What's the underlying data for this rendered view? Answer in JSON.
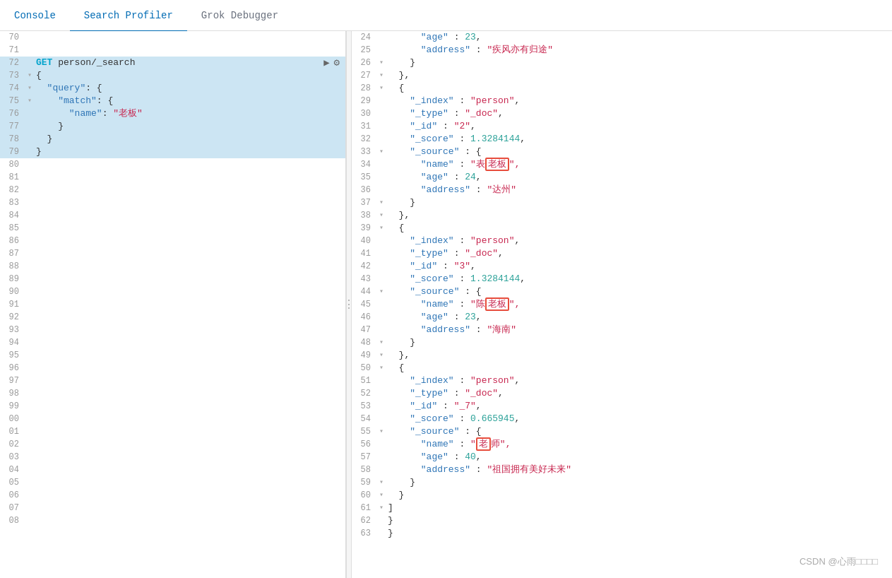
{
  "nav": {
    "items": [
      {
        "label": "Console",
        "active": false
      },
      {
        "label": "Search Profiler",
        "active": true
      },
      {
        "label": "Grok Debugger",
        "active": false
      }
    ]
  },
  "editor": {
    "lines": [
      {
        "num": "70",
        "fold": "",
        "content": ""
      },
      {
        "num": "71",
        "fold": "",
        "content": ""
      },
      {
        "num": "72",
        "fold": "",
        "content": "GET person/_search",
        "highlighted": true,
        "isGetLine": true
      },
      {
        "num": "73",
        "fold": "▾",
        "content": "{",
        "highlighted": true
      },
      {
        "num": "74",
        "fold": "▾",
        "content": "  \"query\": {",
        "highlighted": true
      },
      {
        "num": "75",
        "fold": "▾",
        "content": "    \"match\": {",
        "highlighted": true
      },
      {
        "num": "76",
        "fold": "",
        "content": "      \"name\": \"老板\"",
        "highlighted": true
      },
      {
        "num": "77",
        "fold": "",
        "content": "    }",
        "highlighted": true
      },
      {
        "num": "78",
        "fold": "",
        "content": "  }",
        "highlighted": true
      },
      {
        "num": "79",
        "fold": "",
        "content": "}",
        "highlighted": true
      },
      {
        "num": "80",
        "fold": "",
        "content": ""
      },
      {
        "num": "81",
        "fold": "",
        "content": ""
      },
      {
        "num": "82",
        "fold": "",
        "content": ""
      },
      {
        "num": "83",
        "fold": "",
        "content": ""
      },
      {
        "num": "84",
        "fold": "",
        "content": ""
      },
      {
        "num": "85",
        "fold": "",
        "content": ""
      },
      {
        "num": "86",
        "fold": "",
        "content": ""
      },
      {
        "num": "87",
        "fold": "",
        "content": ""
      },
      {
        "num": "88",
        "fold": "",
        "content": ""
      },
      {
        "num": "89",
        "fold": "",
        "content": ""
      },
      {
        "num": "90",
        "fold": "",
        "content": ""
      },
      {
        "num": "91",
        "fold": "",
        "content": ""
      },
      {
        "num": "92",
        "fold": "",
        "content": ""
      },
      {
        "num": "93",
        "fold": "",
        "content": ""
      },
      {
        "num": "94",
        "fold": "",
        "content": ""
      },
      {
        "num": "95",
        "fold": "",
        "content": ""
      },
      {
        "num": "96",
        "fold": "",
        "content": ""
      },
      {
        "num": "97",
        "fold": "",
        "content": ""
      },
      {
        "num": "98",
        "fold": "",
        "content": ""
      },
      {
        "num": "99",
        "fold": "",
        "content": ""
      },
      {
        "num": "00",
        "fold": "",
        "content": ""
      },
      {
        "num": "01",
        "fold": "",
        "content": ""
      },
      {
        "num": "02",
        "fold": "",
        "content": ""
      },
      {
        "num": "03",
        "fold": "",
        "content": ""
      },
      {
        "num": "04",
        "fold": "",
        "content": ""
      },
      {
        "num": "05",
        "fold": "",
        "content": ""
      },
      {
        "num": "06",
        "fold": "",
        "content": ""
      },
      {
        "num": "07",
        "fold": "",
        "content": ""
      },
      {
        "num": "08",
        "fold": "",
        "content": ""
      }
    ]
  },
  "results": {
    "lines": [
      {
        "num": "24",
        "fold": "",
        "content": "      \"age\" : 23,"
      },
      {
        "num": "25",
        "fold": "",
        "content": "      \"address\" : \"疾风亦有归途\""
      },
      {
        "num": "26",
        "fold": "▾",
        "content": "    }"
      },
      {
        "num": "27",
        "fold": "▾",
        "content": "  },"
      },
      {
        "num": "28",
        "fold": "▾",
        "content": "  {"
      },
      {
        "num": "29",
        "fold": "",
        "content": "    \"_index\" : \"person\","
      },
      {
        "num": "30",
        "fold": "",
        "content": "    \"_type\" : \"_doc\","
      },
      {
        "num": "31",
        "fold": "",
        "content": "    \"_id\" : \"2\","
      },
      {
        "num": "32",
        "fold": "",
        "content": "    \"_score\" : 1.3284144,"
      },
      {
        "num": "33",
        "fold": "▾",
        "content": "    \"_source\" : {"
      },
      {
        "num": "34",
        "fold": "",
        "content": "      \"name\" : \"表老板\",",
        "highlight": "老板"
      },
      {
        "num": "35",
        "fold": "",
        "content": "      \"age\" : 24,"
      },
      {
        "num": "36",
        "fold": "",
        "content": "      \"address\" : \"达州\""
      },
      {
        "num": "37",
        "fold": "▾",
        "content": "    }"
      },
      {
        "num": "38",
        "fold": "▾",
        "content": "  },"
      },
      {
        "num": "39",
        "fold": "▾",
        "content": "  {"
      },
      {
        "num": "40",
        "fold": "",
        "content": "    \"_index\" : \"person\","
      },
      {
        "num": "41",
        "fold": "",
        "content": "    \"_type\" : \"_doc\","
      },
      {
        "num": "42",
        "fold": "",
        "content": "    \"_id\" : \"3\","
      },
      {
        "num": "43",
        "fold": "",
        "content": "    \"_score\" : 1.3284144,"
      },
      {
        "num": "44",
        "fold": "▾",
        "content": "    \"_source\" : {"
      },
      {
        "num": "45",
        "fold": "",
        "content": "      \"name\" : \"陈老板\",",
        "highlight": "老板"
      },
      {
        "num": "46",
        "fold": "",
        "content": "      \"age\" : 23,"
      },
      {
        "num": "47",
        "fold": "",
        "content": "      \"address\" : \"海南\""
      },
      {
        "num": "48",
        "fold": "▾",
        "content": "    }"
      },
      {
        "num": "49",
        "fold": "▾",
        "content": "  },"
      },
      {
        "num": "50",
        "fold": "▾",
        "content": "  {"
      },
      {
        "num": "51",
        "fold": "",
        "content": "    \"_index\" : \"person\","
      },
      {
        "num": "52",
        "fold": "",
        "content": "    \"_type\" : \"_doc\","
      },
      {
        "num": "53",
        "fold": "",
        "content": "    \"_id\" : \"_7\","
      },
      {
        "num": "54",
        "fold": "",
        "content": "    \"_score\" : 0.665945,"
      },
      {
        "num": "55",
        "fold": "▾",
        "content": "    \"_source\" : {"
      },
      {
        "num": "56",
        "fold": "",
        "content": "      \"name\" : \"老师\",",
        "highlight": "老"
      },
      {
        "num": "57",
        "fold": "",
        "content": "      \"age\" : 40,"
      },
      {
        "num": "58",
        "fold": "",
        "content": "      \"address\" : \"祖国拥有美好未来\""
      },
      {
        "num": "59",
        "fold": "▾",
        "content": "    }"
      },
      {
        "num": "60",
        "fold": "▾",
        "content": "  }"
      },
      {
        "num": "61",
        "fold": "▾",
        "content": "]"
      },
      {
        "num": "62",
        "fold": "",
        "content": "}"
      },
      {
        "num": "63",
        "fold": "",
        "content": "}"
      }
    ]
  },
  "watermark": "CSDN @心雨□□□□"
}
